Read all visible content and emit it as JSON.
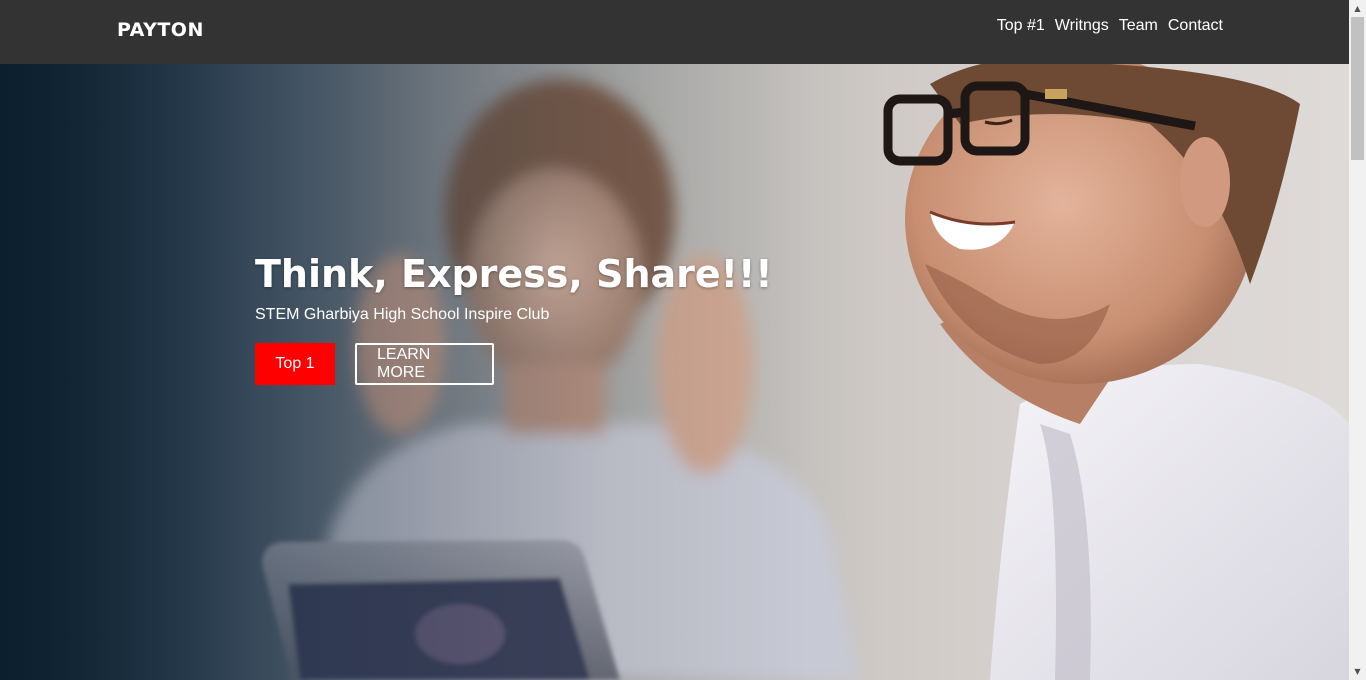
{
  "navbar": {
    "brand": "PAYTON",
    "links": [
      "Top #1",
      "Writngs",
      "Team",
      "Contact"
    ]
  },
  "hero": {
    "title": "Think, Express, Share!!!",
    "subtitle": "STEM Gharbiya High School Inspire Club",
    "primary_button": "Top 1",
    "secondary_button": "LEARN MORE"
  },
  "scrollbar": {
    "up_icon": "▲",
    "down_icon": "▼"
  },
  "colors": {
    "navbar_bg": "#333333",
    "primary_button_bg": "#ff0000",
    "text": "#ffffff"
  }
}
